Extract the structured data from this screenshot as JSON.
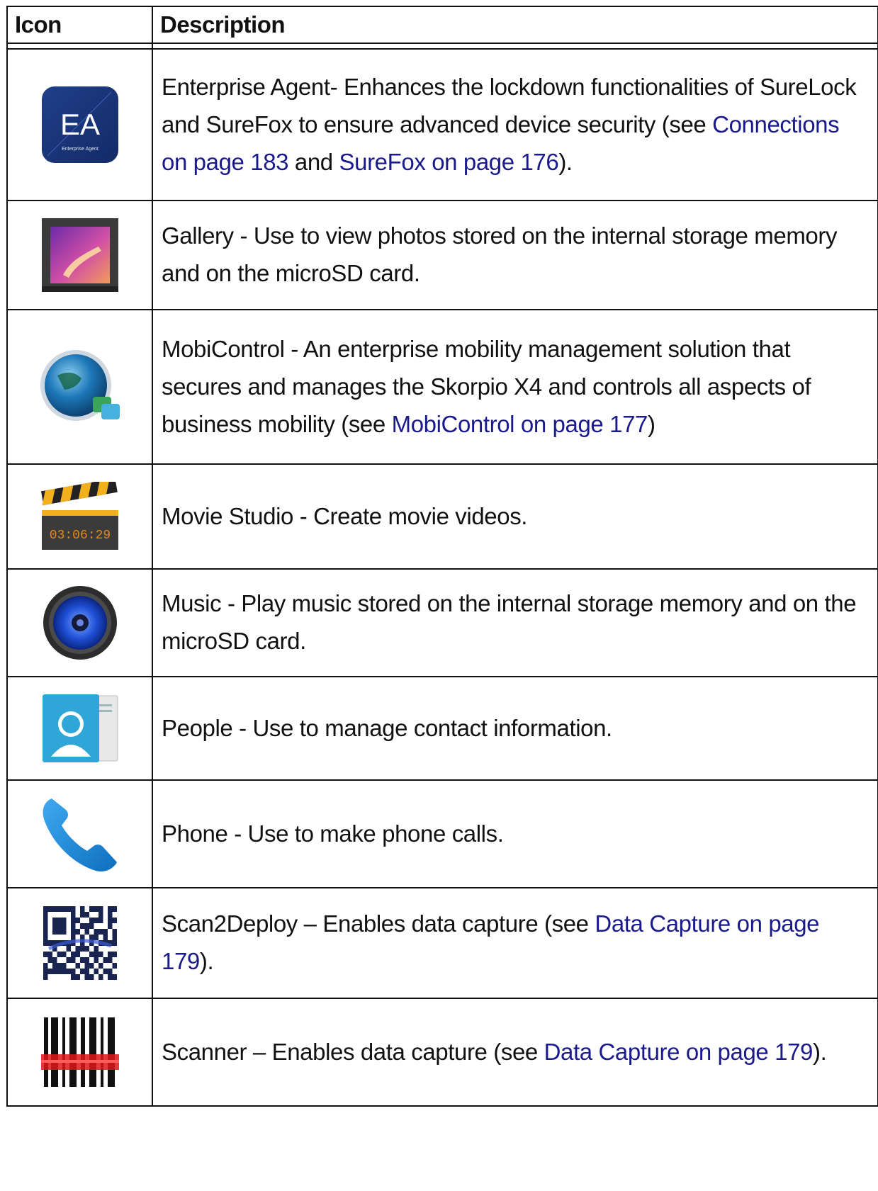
{
  "table": {
    "headers": {
      "icon": "Icon",
      "description": "Description"
    },
    "rows": [
      {
        "icon": "enterprise-agent-icon",
        "segments": [
          {
            "text": "Enterprise Agent- Enhances the lockdown functionalities of SureLock and SureFox to ensure advanced device security (see "
          },
          {
            "text": "Connections on page 183",
            "link": true
          },
          {
            "text": " and "
          },
          {
            "text": "SureFox on page 176",
            "link": true
          },
          {
            "text": ")."
          }
        ],
        "icon_text": {
          "letters": "EA",
          "caption": "Enterprise Agent"
        }
      },
      {
        "icon": "gallery-icon",
        "segments": [
          {
            "text": "Gallery - Use to view photos stored on the internal storage memory and on the microSD card."
          }
        ]
      },
      {
        "icon": "mobicontrol-icon",
        "segments": [
          {
            "text": "MobiControl - An enterprise mobility management solution that secures and manages the Skorpio X4 and controls all aspects of business mobility (see "
          },
          {
            "text": "MobiControl on page 177",
            "link": true
          },
          {
            "text": ")"
          }
        ]
      },
      {
        "icon": "movie-studio-icon",
        "segments": [
          {
            "text": "Movie Studio - Create movie videos."
          }
        ],
        "icon_text": {
          "timecode": "03:06:29"
        }
      },
      {
        "icon": "music-icon",
        "segments": [
          {
            "text": "Music - Play music stored on the internal storage memory and on the microSD card."
          }
        ]
      },
      {
        "icon": "people-icon",
        "segments": [
          {
            "text": "People - Use to manage contact information."
          }
        ]
      },
      {
        "icon": "phone-icon",
        "segments": [
          {
            "text": "Phone - Use to make phone calls."
          }
        ]
      },
      {
        "icon": "scan2deploy-icon",
        "segments": [
          {
            "text": "Scan2Deploy – Enables data capture (see "
          },
          {
            "text": "Data Capture on page 179",
            "link": true
          },
          {
            "text": ")."
          }
        ]
      },
      {
        "icon": "scanner-icon",
        "segments": [
          {
            "text": "Scanner – Enables data capture (see "
          },
          {
            "text": "Data Capture on page 179",
            "link": true
          },
          {
            "text": ")."
          }
        ]
      }
    ]
  },
  "colors": {
    "link": "#1a1a8c",
    "border": "#111111",
    "text": "#111111"
  }
}
